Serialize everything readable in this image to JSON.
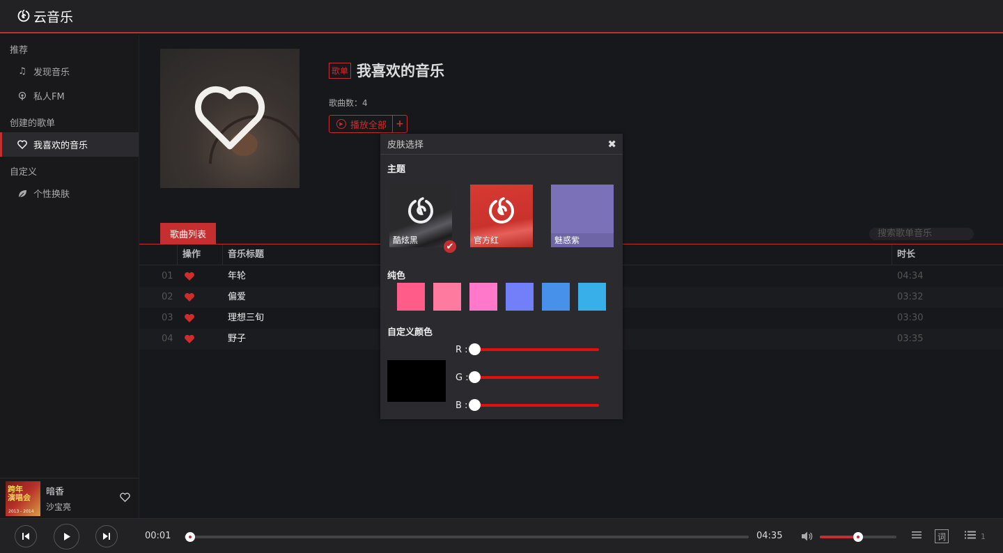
{
  "app": {
    "title": "云音乐"
  },
  "sidebar": {
    "groups": [
      {
        "label": "推荐",
        "items": [
          {
            "label": "发现音乐",
            "icon": "music-note-icon"
          },
          {
            "label": "私人FM",
            "icon": "radio-icon"
          }
        ]
      },
      {
        "label": "创建的歌单",
        "items": [
          {
            "label": "我喜欢的音乐",
            "icon": "heart-icon",
            "active": true
          }
        ]
      },
      {
        "label": "自定义",
        "items": [
          {
            "label": "个性换肤",
            "icon": "leaf-icon"
          }
        ]
      }
    ]
  },
  "now_playing": {
    "title": "暗香",
    "artist": "沙宝亮",
    "cover_text_top": "跨年",
    "cover_text_mid": "演唱会",
    "cover_text_bottom": "2013 - 2014"
  },
  "playlist": {
    "badge": "歌单",
    "title": "我喜欢的音乐",
    "count_label": "歌曲数：4",
    "play_all_label": "播放全部",
    "add_label": "+"
  },
  "song_list": {
    "tab_label": "歌曲列表",
    "search_placeholder": "搜索歌单音乐",
    "columns": {
      "action": "操作",
      "title": "音乐标题",
      "duration": "时长"
    },
    "rows": [
      {
        "no": "01",
        "title": "年轮",
        "duration": "04:34"
      },
      {
        "no": "02",
        "title": "偏爱",
        "duration": "03:32"
      },
      {
        "no": "03",
        "title": "理想三旬",
        "duration": "03:30"
      },
      {
        "no": "04",
        "title": "野子",
        "duration": "03:35"
      }
    ]
  },
  "skin_dialog": {
    "title": "皮肤选择",
    "close": "✖",
    "theme_section": "主题",
    "themes": [
      {
        "label": "酷炫黑",
        "color": "#222225",
        "selected": true
      },
      {
        "label": "官方红",
        "color": "#d33a31",
        "selected": false
      },
      {
        "label": "魅惑紫",
        "color": "#7b71b8",
        "selected": false
      }
    ],
    "solid_section": "纯色",
    "solid_colors": [
      "#ff5c8a",
      "#ff7a9e",
      "#ff78c9",
      "#717ff9",
      "#4791eb",
      "#39afea"
    ],
    "custom_section": "自定义颜色",
    "custom_color": "#000000",
    "sliders": [
      {
        "label": "R :",
        "value": 0
      },
      {
        "label": "G :",
        "value": 0
      },
      {
        "label": "B :",
        "value": 0
      }
    ]
  },
  "player": {
    "current_time": "00:01",
    "total_time": "04:35",
    "progress": 0.01,
    "volume": 0.5,
    "lyric_label": "词",
    "playlist_count": "1",
    "accent": "#c62f2f"
  }
}
